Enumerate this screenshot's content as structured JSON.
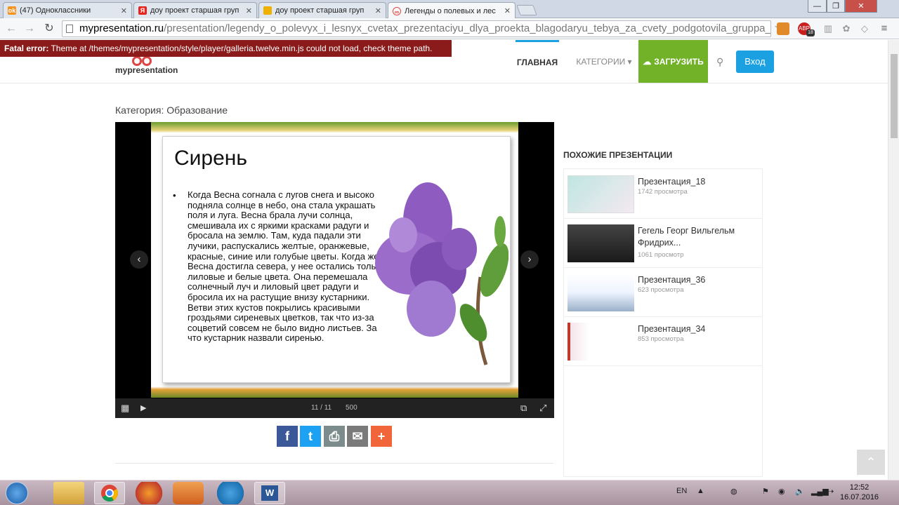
{
  "tabs": [
    {
      "title": "(47) Одноклассники",
      "icon": "ok-icon",
      "color": "#f7931e"
    },
    {
      "title": "доу проект старшая груп",
      "icon": "yandex-icon",
      "color": "#e52620"
    },
    {
      "title": "доу проект старшая груп",
      "icon": "folder-icon",
      "color": "#f0b000"
    },
    {
      "title": "Легенды о полевых и лес",
      "icon": "mypresentation-icon",
      "color": "#e04545"
    }
  ],
  "window": {
    "minimize": "—",
    "maximize": "❐",
    "close": "✕"
  },
  "url": {
    "host": "mypresentation.ru",
    "path": "/presentation/legendy_o_polevyx_i_lesnyx_cvetax_prezentaciyu_dlya_proekta_blagodaryu_tebya_za_cvety_podgotovila_gruppa_is"
  },
  "extensions": {
    "abp_label": "ABP",
    "abp_badge": "18"
  },
  "error": {
    "label": "Fatal error:",
    "message": " Theme at /themes/mypresentation/style/player/galleria.twelve.min.js could not load, check theme path."
  },
  "site": {
    "logo": "mypresentation"
  },
  "nav": {
    "home": "ГЛАВНАЯ",
    "categories": "КАТЕГОРИИ ▾",
    "upload": "ЗАГРУЗИТЬ",
    "login": "Вход"
  },
  "category": "Категория: Образование",
  "slide": {
    "title": "Сирень",
    "bullet": "•",
    "text": "Когда Весна согнала с лугов снега и высоко подняла солнце в небо, она стала украшать поля и луга. Весна брала лучи солнца, смешивала их с яркими красками радуги и бросала на землю. Там, куда падали эти лучики, распускались желтые, оранжевые, красные, синие или голубые цветы. Когда же Весна достигла севера, у нее остались только лиловые и белые цвета. Она перемешала солнечный луч и лиловый цвет радуги и бросила их на растущие внизу кустарники. Ветви этих кустов покрылись красивыми гроздьями сиреневых цветков, так что из-за соцветий совсем не было видно листьев. За что кустарник назвали сиренью."
  },
  "player": {
    "counter": "11 / 11",
    "size": "500",
    "prev": "‹",
    "next": "›"
  },
  "share": [
    {
      "name": "facebook",
      "label": "f",
      "color": "#3b5998"
    },
    {
      "name": "twitter",
      "label": "t",
      "color": "#1da1f2"
    },
    {
      "name": "print",
      "label": "⎙",
      "color": "#7c8c8c"
    },
    {
      "name": "email",
      "label": "✉",
      "color": "#7a7a7a"
    },
    {
      "name": "more",
      "label": "+",
      "color": "#f0653a"
    }
  ],
  "sidebar": {
    "heading": "ПОХОЖИЕ ПРЕЗЕНТАЦИИ",
    "items": [
      {
        "title": "Презентация_18",
        "views": "1742 просмотра"
      },
      {
        "title": "Гегель Георг Вильгельм Фридрих...",
        "views": "1061 просмотр"
      },
      {
        "title": "Презентация_36",
        "views": "623 просмотра"
      },
      {
        "title": "Презентация_34",
        "views": "853 просмотра"
      }
    ]
  },
  "taskbar": {
    "lang": "EN",
    "time": "12:52",
    "date": "16.07.2016"
  }
}
